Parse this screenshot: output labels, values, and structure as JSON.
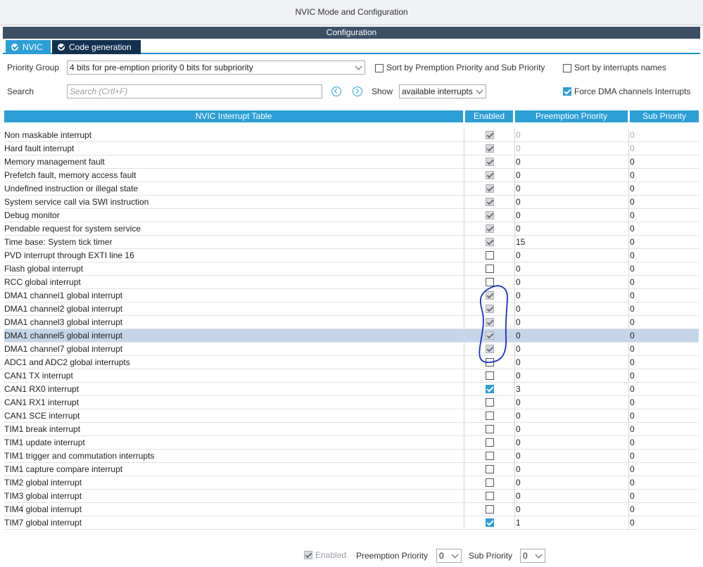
{
  "window": {
    "title": "NVIC Mode and Configuration"
  },
  "config_header": "Configuration",
  "tabs": [
    {
      "label": "NVIC",
      "active": true
    },
    {
      "label": "Code generation",
      "active": false
    }
  ],
  "toolbar": {
    "priority_group_label": "Priority Group",
    "priority_group_value": "4 bits for pre-emption priority 0 bits for subpriority",
    "sort_preemption_label": "Sort by Premption Priority and Sub Priority",
    "sort_names_label": "Sort by interrupts names",
    "search_label": "Search",
    "search_placeholder": "Search (Crtl+F)",
    "show_label": "Show",
    "show_value": "available interrupts",
    "force_dma_label": "Force DMA channels Interrupts"
  },
  "table": {
    "headers": [
      "NVIC Interrupt Table",
      "Enabled",
      "Preemption Priority",
      "Sub Priority"
    ],
    "rows": [
      {
        "name": "Non maskable interrupt",
        "enabled": true,
        "locked": true,
        "preemption": "0",
        "sub": "0",
        "grey_values": true
      },
      {
        "name": "Hard fault interrupt",
        "enabled": true,
        "locked": true,
        "preemption": "0",
        "sub": "0",
        "grey_values": true
      },
      {
        "name": "Memory management fault",
        "enabled": true,
        "locked": true,
        "preemption": "0",
        "sub": "0"
      },
      {
        "name": "Prefetch fault, memory access fault",
        "enabled": true,
        "locked": true,
        "preemption": "0",
        "sub": "0"
      },
      {
        "name": "Undefined instruction or illegal state",
        "enabled": true,
        "locked": true,
        "preemption": "0",
        "sub": "0"
      },
      {
        "name": "System service call via SWI instruction",
        "enabled": true,
        "locked": true,
        "preemption": "0",
        "sub": "0"
      },
      {
        "name": "Debug monitor",
        "enabled": true,
        "locked": true,
        "preemption": "0",
        "sub": "0"
      },
      {
        "name": "Pendable request for system service",
        "enabled": true,
        "locked": true,
        "preemption": "0",
        "sub": "0"
      },
      {
        "name": "Time base: System tick timer",
        "enabled": true,
        "locked": true,
        "preemption": "15",
        "sub": "0"
      },
      {
        "name": "PVD interrupt through EXTI line 16",
        "enabled": false,
        "locked": false,
        "preemption": "0",
        "sub": "0"
      },
      {
        "name": "Flash global interrupt",
        "enabled": false,
        "locked": false,
        "preemption": "0",
        "sub": "0"
      },
      {
        "name": "RCC global interrupt",
        "enabled": false,
        "locked": false,
        "preemption": "0",
        "sub": "0"
      },
      {
        "name": "DMA1 channel1 global interrupt",
        "enabled": true,
        "locked": true,
        "preemption": "0",
        "sub": "0"
      },
      {
        "name": "DMA1 channel2 global interrupt",
        "enabled": true,
        "locked": true,
        "preemption": "0",
        "sub": "0"
      },
      {
        "name": "DMA1 channel3 global interrupt",
        "enabled": true,
        "locked": true,
        "preemption": "0",
        "sub": "0"
      },
      {
        "name": "DMA1 channel5 global interrupt",
        "enabled": true,
        "locked": true,
        "preemption": "0",
        "sub": "0",
        "selected": true
      },
      {
        "name": "DMA1 channel7 global interrupt",
        "enabled": true,
        "locked": true,
        "preemption": "0",
        "sub": "0"
      },
      {
        "name": "ADC1 and ADC2 global interrupts",
        "enabled": false,
        "locked": false,
        "preemption": "0",
        "sub": "0"
      },
      {
        "name": "CAN1 TX interrupt",
        "enabled": false,
        "locked": false,
        "preemption": "0",
        "sub": "0"
      },
      {
        "name": "CAN1 RX0 interrupt",
        "enabled": true,
        "locked": false,
        "preemption": "3",
        "sub": "0"
      },
      {
        "name": "CAN1 RX1 interrupt",
        "enabled": false,
        "locked": false,
        "preemption": "0",
        "sub": "0"
      },
      {
        "name": "CAN1 SCE interrupt",
        "enabled": false,
        "locked": false,
        "preemption": "0",
        "sub": "0"
      },
      {
        "name": "TIM1 break interrupt",
        "enabled": false,
        "locked": false,
        "preemption": "0",
        "sub": "0"
      },
      {
        "name": "TIM1 update interrupt",
        "enabled": false,
        "locked": false,
        "preemption": "0",
        "sub": "0"
      },
      {
        "name": "TIM1 trigger and commutation interrupts",
        "enabled": false,
        "locked": false,
        "preemption": "0",
        "sub": "0"
      },
      {
        "name": "TIM1 capture compare interrupt",
        "enabled": false,
        "locked": false,
        "preemption": "0",
        "sub": "0"
      },
      {
        "name": "TIM2 global interrupt",
        "enabled": false,
        "locked": false,
        "preemption": "0",
        "sub": "0"
      },
      {
        "name": "TIM3 global interrupt",
        "enabled": false,
        "locked": false,
        "preemption": "0",
        "sub": "0"
      },
      {
        "name": "TIM4 global interrupt",
        "enabled": false,
        "locked": false,
        "preemption": "0",
        "sub": "0"
      },
      {
        "name": "TIM7 global interrupt",
        "enabled": true,
        "locked": false,
        "preemption": "1",
        "sub": "0"
      }
    ]
  },
  "bottom_bar": {
    "enabled_label": "Enabled",
    "preemption_label": "Preemption Priority",
    "preemption_value": "0",
    "sub_label": "Sub Priority",
    "sub_value": "0"
  },
  "colors": {
    "accent": "#2b9fd6",
    "config_bar": "#3b4f67",
    "selected_row": "#c5d6ea",
    "annotation_ink": "#1a2fc4"
  }
}
